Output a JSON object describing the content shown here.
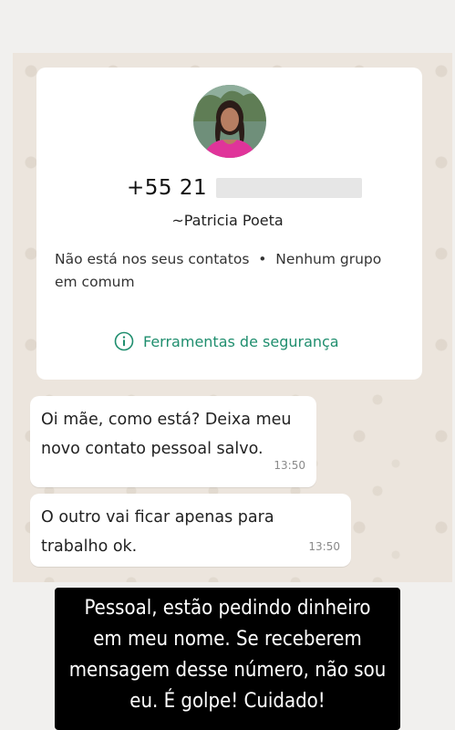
{
  "contact": {
    "phone_visible": "+55 21",
    "name": "~Patricia Poeta",
    "info_line1": "Não está nos seus contatos  •  Nenhum grupo",
    "info_line2": "em comum",
    "security_label": "Ferramentas de segurança"
  },
  "messages": [
    {
      "line1": "Oi mãe, como está? Deixa meu",
      "line2": "novo contato pessoal salvo.",
      "time": "13:50"
    },
    {
      "line1": "O outro vai ficar apenas para",
      "line2": "trabalho ok.",
      "time": "13:50"
    }
  ],
  "caption": {
    "line1": "Pessoal, estão pedindo dinheiro",
    "line2": "em meu nome. Se receberem",
    "line3": "mensagem desse número, não sou",
    "line4": "eu. É golpe! Cuidado!"
  },
  "colors": {
    "security_green": "#1f8e6e",
    "chat_background": "#ece5dd",
    "caption_background": "#000000"
  },
  "icons": {
    "security": "info-circle-icon",
    "avatar": "profile-photo"
  }
}
